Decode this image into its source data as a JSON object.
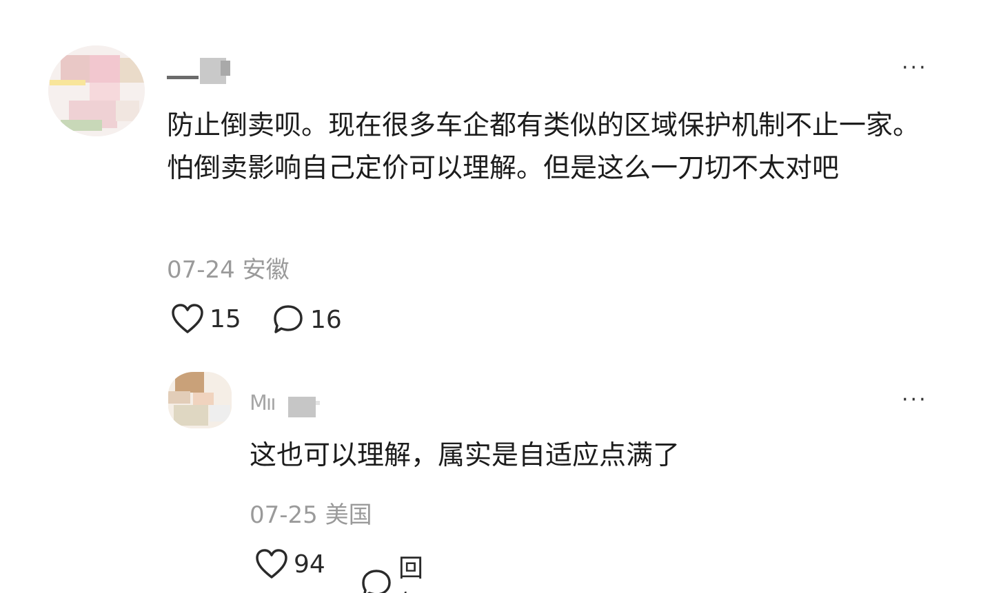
{
  "comments": [
    {
      "text": "防止倒卖呗。现在很多车企都有类似的区域保护机制不止一家。怕倒卖影响自己定价可以理解。但是这么一刀切不太对吧",
      "date": "07-24",
      "location": "安徽",
      "likes": "15",
      "replies": "16",
      "more_label": "···"
    }
  ],
  "reply": {
    "username_fragment": "Mıı",
    "text": "这也可以理解，属实是自适应点满了",
    "date": "07-25",
    "location": "美国",
    "likes": "94",
    "reply_label": "回复",
    "more_label": "···"
  },
  "icons": {
    "like": "heart-icon",
    "comment": "speech-bubble-icon",
    "more": "ellipsis-icon"
  },
  "colors": {
    "text": "#1c1c1c",
    "meta": "#9a9a9a",
    "icon": "#2a2a2a"
  }
}
